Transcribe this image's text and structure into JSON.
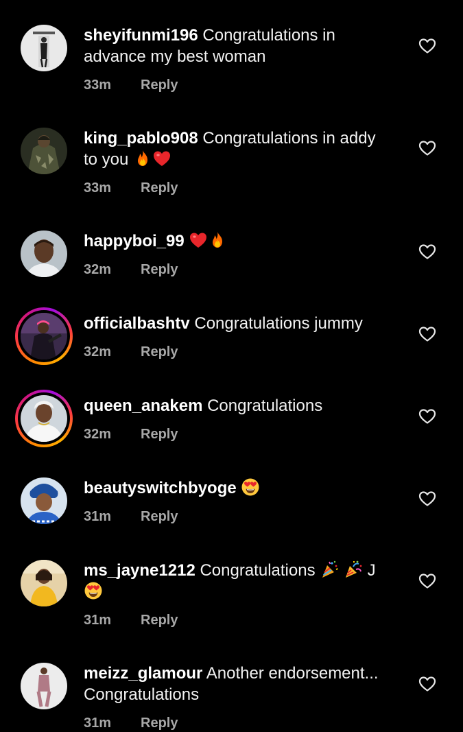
{
  "comments": [
    {
      "username": "sheyifunmi196",
      "text_line1": "Congratulations in",
      "text_line2": "advance my best woman",
      "time": "33m",
      "reply": "Reply",
      "story_ring": false
    },
    {
      "username": "king_pablo908",
      "text_line1": "Congratulations in addy",
      "text_line2": "to you",
      "emojis": [
        "fire-emoji",
        "red-heart-emoji"
      ],
      "time": "33m",
      "reply": "Reply",
      "story_ring": false
    },
    {
      "username": "happyboi_99",
      "emojis": [
        "red-heart-emoji",
        "fire-emoji"
      ],
      "time": "32m",
      "reply": "Reply",
      "story_ring": false
    },
    {
      "username": "officialbashtv",
      "text_line1": "Congratulations jummy",
      "time": "32m",
      "reply": "Reply",
      "story_ring": true
    },
    {
      "username": "queen_anakem",
      "text_line1": "Congratulations",
      "time": "32m",
      "reply": "Reply",
      "story_ring": true
    },
    {
      "username": "beautyswitchbyoge",
      "emojis": [
        "heart-eyes-emoji"
      ],
      "time": "31m",
      "reply": "Reply",
      "story_ring": false
    },
    {
      "username": "ms_jayne1212",
      "text_line1": "Congratulations",
      "text_line1_tail": "J",
      "emojis": [
        "confetti-ball-emoji",
        "party-popper-emoji",
        "heart-eyes-emoji"
      ],
      "time": "31m",
      "reply": "Reply",
      "story_ring": false
    },
    {
      "username": "meizz_glamour",
      "text_line1": "Another endorsement...",
      "text_line2": "Congratulations",
      "time": "31m",
      "reply": "Reply",
      "story_ring": false
    }
  ],
  "colors": {
    "background": "#000000",
    "text": "#f2f2f2",
    "meta": "#a8a8a8",
    "story_ring": [
      "#ff8a00",
      "#d1167e",
      "#a30ddf"
    ]
  }
}
